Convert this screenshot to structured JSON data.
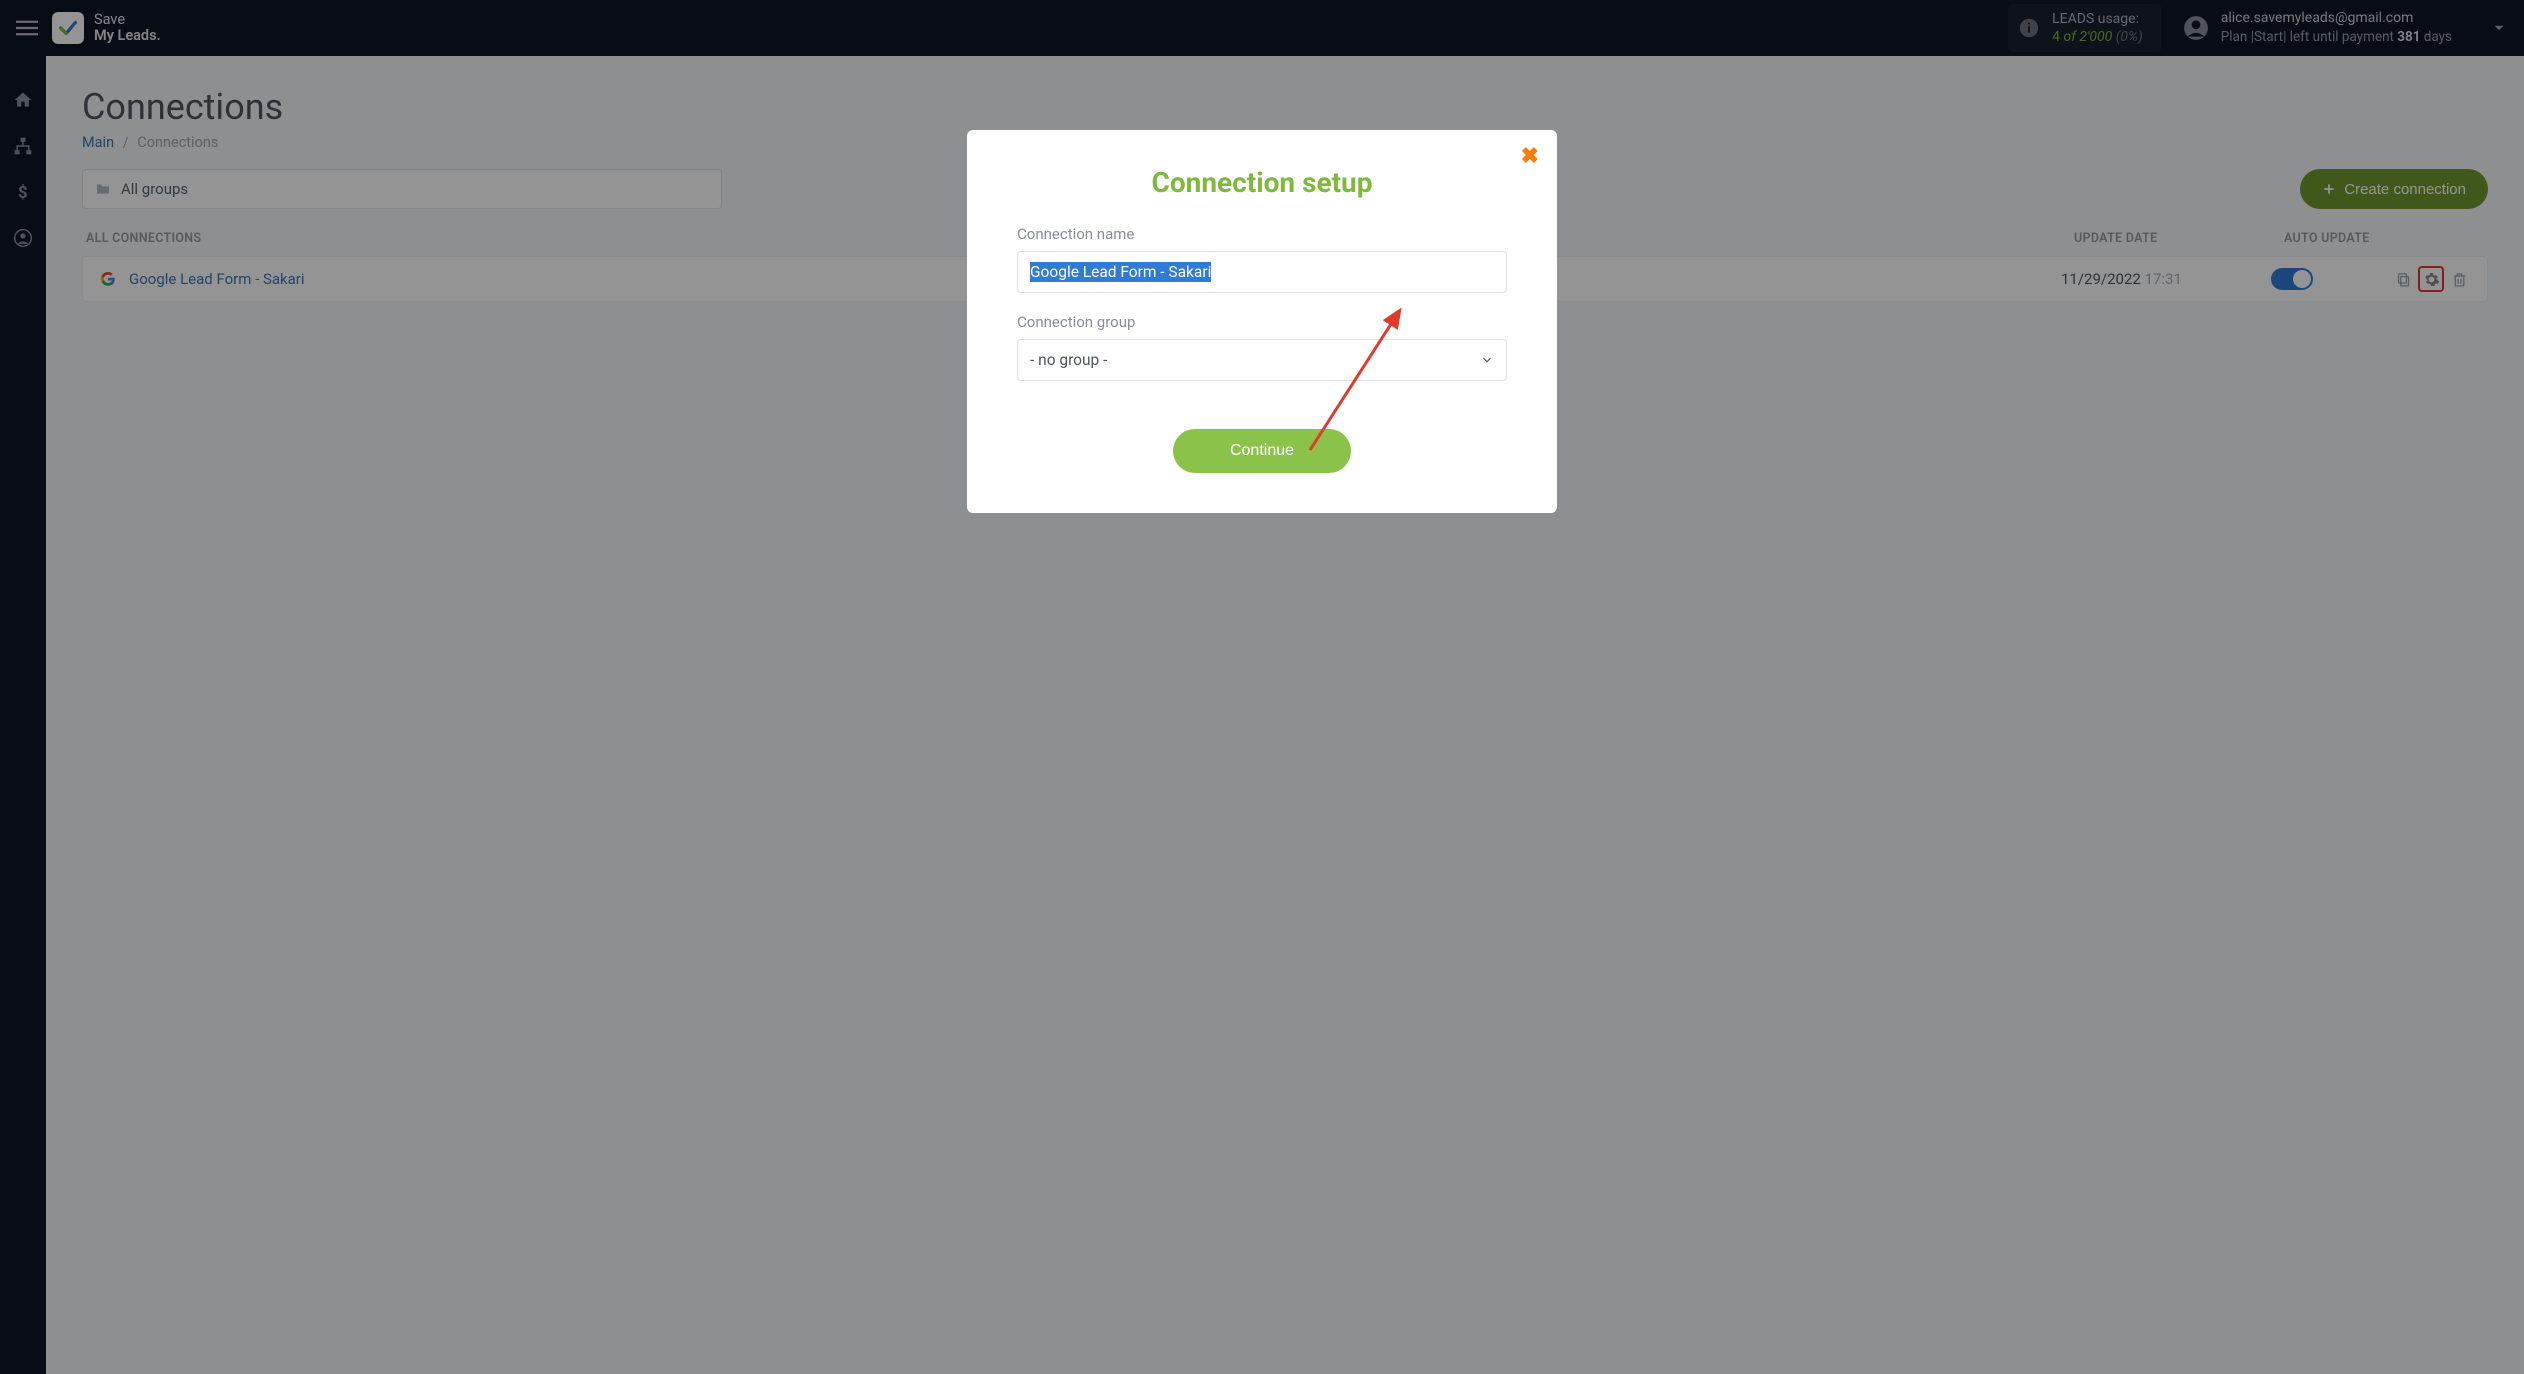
{
  "brand": {
    "line1": "Save",
    "line2": "My Leads."
  },
  "usage": {
    "label": "LEADS usage:",
    "used": "4",
    "of_word": "of",
    "limit": "2'000",
    "pct": "(0%)"
  },
  "account": {
    "email": "alice.savemyleads@gmail.com",
    "plan_prefix": "Plan |Start| left until payment ",
    "days": "381",
    "days_suffix": " days"
  },
  "page": {
    "title": "Connections",
    "crumb_main": "Main",
    "crumb_current": "Connections"
  },
  "toolbar": {
    "group_label": "All groups",
    "create_label": "Create connection"
  },
  "table": {
    "head_all": "ALL CONNECTIONS",
    "head_update": "UPDATE DATE",
    "head_auto": "AUTO UPDATE"
  },
  "row": {
    "name": "Google Lead Form - Sakari",
    "date": "11/29/2022",
    "time": "17:31"
  },
  "modal": {
    "title": "Connection setup",
    "name_label": "Connection name",
    "name_value": "Google Lead Form - Sakari",
    "group_label": "Connection group",
    "group_value": "- no group -",
    "continue": "Continue"
  }
}
